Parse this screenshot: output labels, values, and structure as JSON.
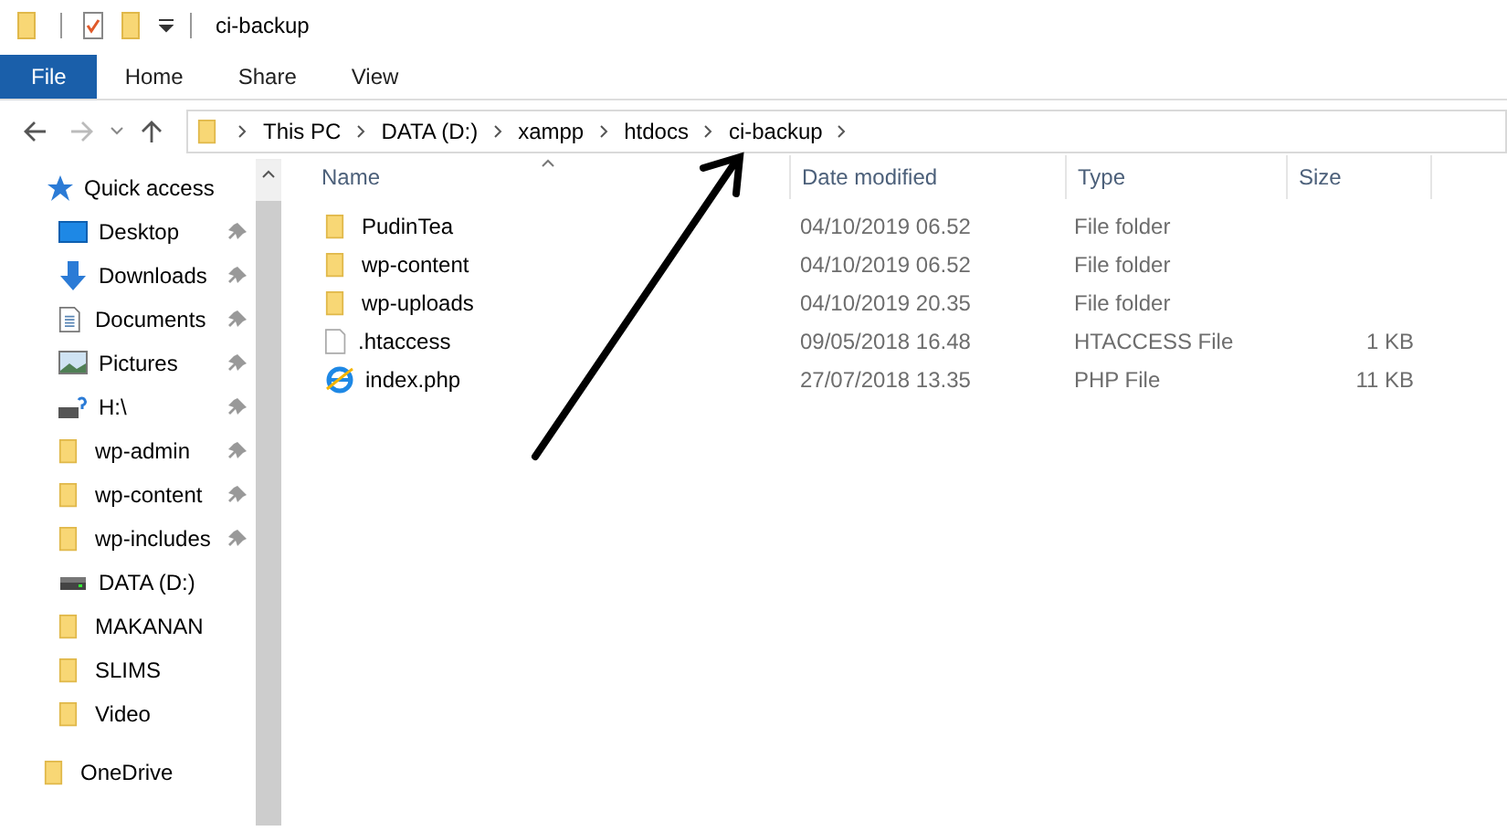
{
  "window": {
    "title": "ci-backup"
  },
  "ribbon_tabs": [
    {
      "label": "File",
      "selected": true
    },
    {
      "label": "Home",
      "selected": false
    },
    {
      "label": "Share",
      "selected": false
    },
    {
      "label": "View",
      "selected": false
    }
  ],
  "breadcrumb": [
    "This PC",
    "DATA (D:)",
    "xampp",
    "htdocs",
    "ci-backup"
  ],
  "sidebar": {
    "items": [
      {
        "label": "Quick access",
        "kind": "quick",
        "children": [
          {
            "label": "Desktop",
            "kind": "desktop",
            "pinned": true
          },
          {
            "label": "Downloads",
            "kind": "downloads",
            "pinned": true
          },
          {
            "label": "Documents",
            "kind": "documents",
            "pinned": true
          },
          {
            "label": "Pictures",
            "kind": "pictures",
            "pinned": true
          },
          {
            "label": "H:\\",
            "kind": "netdrive",
            "pinned": true
          },
          {
            "label": "wp-admin",
            "kind": "folder",
            "pinned": true
          },
          {
            "label": "wp-content",
            "kind": "folder",
            "pinned": true
          },
          {
            "label": "wp-includes",
            "kind": "folder",
            "pinned": true
          },
          {
            "label": "DATA (D:)",
            "kind": "drive",
            "pinned": false
          },
          {
            "label": "MAKANAN",
            "kind": "folder",
            "pinned": false
          },
          {
            "label": "SLIMS",
            "kind": "folder",
            "pinned": false
          },
          {
            "label": "Video",
            "kind": "folder",
            "pinned": false
          }
        ]
      },
      {
        "label": "OneDrive",
        "kind": "folder"
      }
    ]
  },
  "table": {
    "columns": [
      "Name",
      "Date modified",
      "Type",
      "Size"
    ],
    "rows": [
      {
        "name": "PudinTea",
        "kind": "folder",
        "date": "04/10/2019 06.52",
        "type": "File folder"
      },
      {
        "name": "wp-content",
        "kind": "folder",
        "date": "04/10/2019 06.52",
        "type": "File folder"
      },
      {
        "name": "wp-uploads",
        "kind": "folder",
        "date": "04/10/2019 20.35",
        "type": "File folder"
      },
      {
        "name": ".htaccess",
        "kind": "file",
        "date": "09/05/2018 16.48",
        "type": "HTACCESS File",
        "size": "1 KB"
      },
      {
        "name": "index.php",
        "kind": "browser",
        "date": "27/07/2018 13.35",
        "type": "PHP File",
        "size": "11 KB"
      }
    ]
  }
}
